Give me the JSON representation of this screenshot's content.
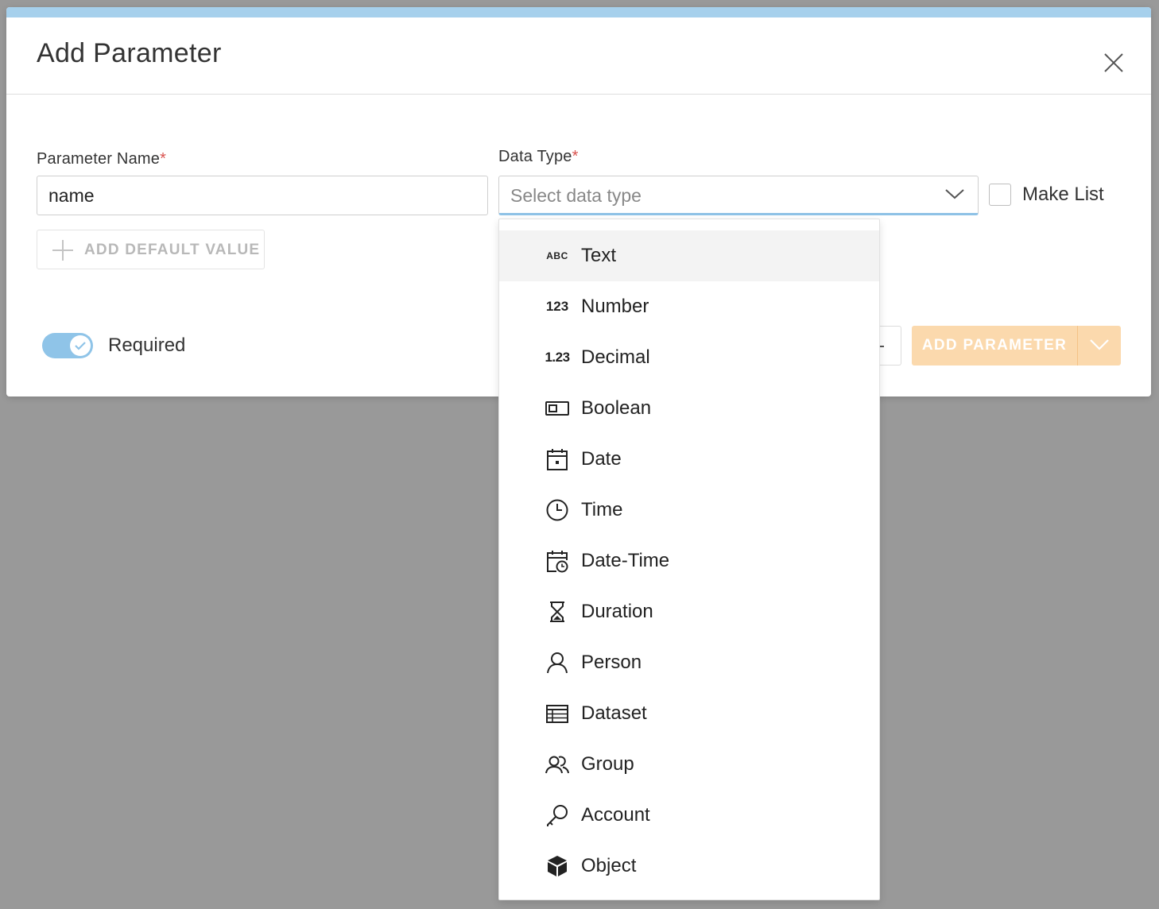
{
  "modal": {
    "title": "Add Parameter",
    "accent_color": "#a6d0ec"
  },
  "form": {
    "parameter_name": {
      "label": "Parameter Name",
      "required_marker": "*",
      "value": "name"
    },
    "data_type": {
      "label": "Data Type",
      "required_marker": "*",
      "placeholder": "Select data type"
    },
    "make_list": {
      "label": "Make List",
      "checked": false
    },
    "add_default_value_label": "ADD DEFAULT VALUE",
    "required_toggle": {
      "label": "Required",
      "on": true
    }
  },
  "footer": {
    "cancel_visible_fragment": "-",
    "add_parameter_label": "ADD PARAMETER",
    "add_button_color": "#fbd9ad"
  },
  "dropdown": {
    "items": [
      {
        "label": "Text",
        "icon": "abc-icon",
        "icon_text": "ABC",
        "highlighted": true
      },
      {
        "label": "Number",
        "icon": "number-icon",
        "icon_text": "123"
      },
      {
        "label": "Decimal",
        "icon": "decimal-icon",
        "icon_text": "1.23"
      },
      {
        "label": "Boolean",
        "icon": "toggle-box-icon"
      },
      {
        "label": "Date",
        "icon": "calendar-icon"
      },
      {
        "label": "Time",
        "icon": "clock-icon"
      },
      {
        "label": "Date-Time",
        "icon": "calendar-clock-icon"
      },
      {
        "label": "Duration",
        "icon": "hourglass-icon"
      },
      {
        "label": "Person",
        "icon": "person-icon"
      },
      {
        "label": "Dataset",
        "icon": "table-icon"
      },
      {
        "label": "Group",
        "icon": "group-icon"
      },
      {
        "label": "Account",
        "icon": "key-icon"
      },
      {
        "label": "Object",
        "icon": "cube-icon"
      }
    ]
  }
}
